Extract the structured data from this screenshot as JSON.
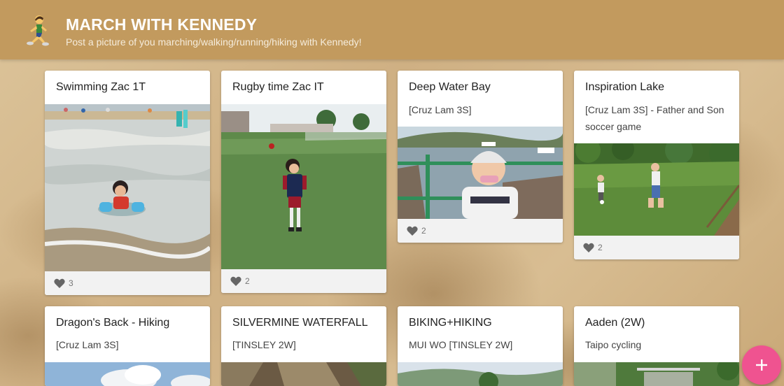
{
  "header": {
    "icon": "runner-emoji",
    "title": "MARCH WITH KENNEDY",
    "subtitle": "Post a picture of you marching/walking/running/hiking with Kennedy!",
    "bg_color": "#c29a5e"
  },
  "posts": [
    {
      "title": "Swimming Zac 1T",
      "text": "",
      "photo": "child-playing-in-sea-waves",
      "likes": "3"
    },
    {
      "title": "Rugby time Zac IT",
      "text": "",
      "photo": "child-in-rugby-kit-on-field",
      "likes": "2"
    },
    {
      "title": "Deep Water Bay",
      "text": "[Cruz Lam 3S]",
      "photo": "child-in-cap-by-bay",
      "likes": "2"
    },
    {
      "title": "Inspiration Lake",
      "text": "[Cruz Lam 3S] - Father and Son soccer game",
      "photo": "father-son-soccer-on-lawn",
      "likes": "2"
    },
    {
      "title": "Dragon's Back - Hiking",
      "text": "[Cruz Lam 3S]",
      "photo": "sky-and-clouds"
    },
    {
      "title": "SILVERMINE WATERFALL",
      "text": "[TINSLEY 2W]",
      "photo": "rocky-waterfall"
    },
    {
      "title": "BIKING+HIKING",
      "text": "MUI WO [TINSLEY 2W]",
      "photo": "green-hills"
    },
    {
      "title": "Aaden (2W)",
      "text": "Taipo cycling",
      "photo": "cycling-path-trees"
    }
  ],
  "like_icon": "heart-icon",
  "fab": {
    "icon": "plus-icon",
    "color": "#ef5390"
  }
}
